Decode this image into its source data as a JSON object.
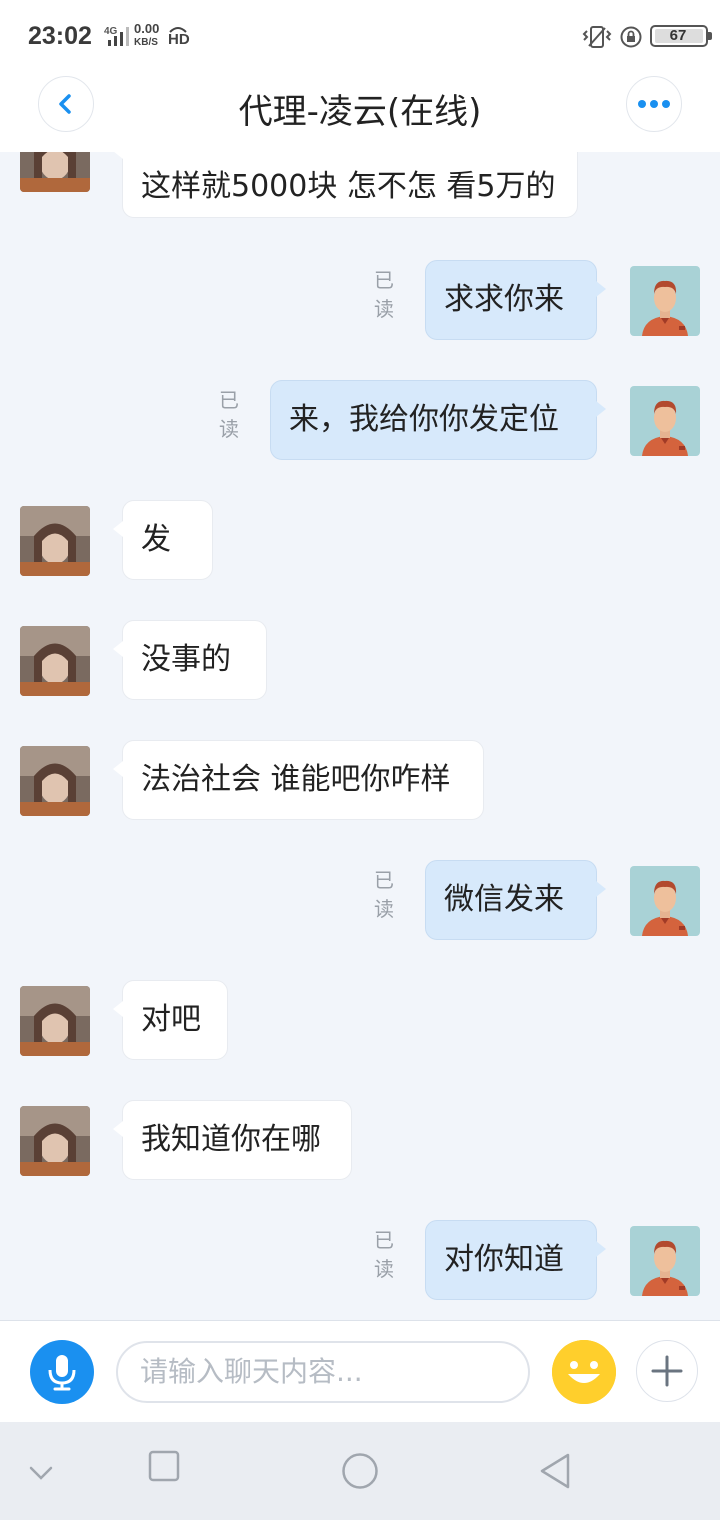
{
  "status_bar": {
    "time": "23:02",
    "network": "4G",
    "speed_value": "0.00",
    "speed_unit": "KB/S",
    "hd": "HD",
    "battery": "67"
  },
  "header": {
    "title": "代理-凌云(在线)"
  },
  "messages": [
    {
      "side": "in",
      "text": "这样就5000块 怎不怎 看5万的"
    },
    {
      "side": "out",
      "text": "求求你来",
      "status": "已读"
    },
    {
      "side": "out",
      "text": "来，我给你你发定位",
      "status": "已读"
    },
    {
      "side": "in",
      "text": "发"
    },
    {
      "side": "in",
      "text": "没事的"
    },
    {
      "side": "in",
      "text": "法治社会 谁能吧你咋样"
    },
    {
      "side": "out",
      "text": "微信发来",
      "status": "已读"
    },
    {
      "side": "in",
      "text": "对吧"
    },
    {
      "side": "in",
      "text": "我知道你在哪"
    },
    {
      "side": "out",
      "text": "对你知道",
      "status": "已读"
    }
  ],
  "input": {
    "placeholder": "请输入聊天内容..."
  },
  "colors": {
    "accent": "#1a90f0",
    "outgoing_bubble": "#d7e9fb",
    "incoming_bubble": "#ffffff",
    "emoji_button": "#ffcf2c",
    "background": "#f2f5fa"
  }
}
